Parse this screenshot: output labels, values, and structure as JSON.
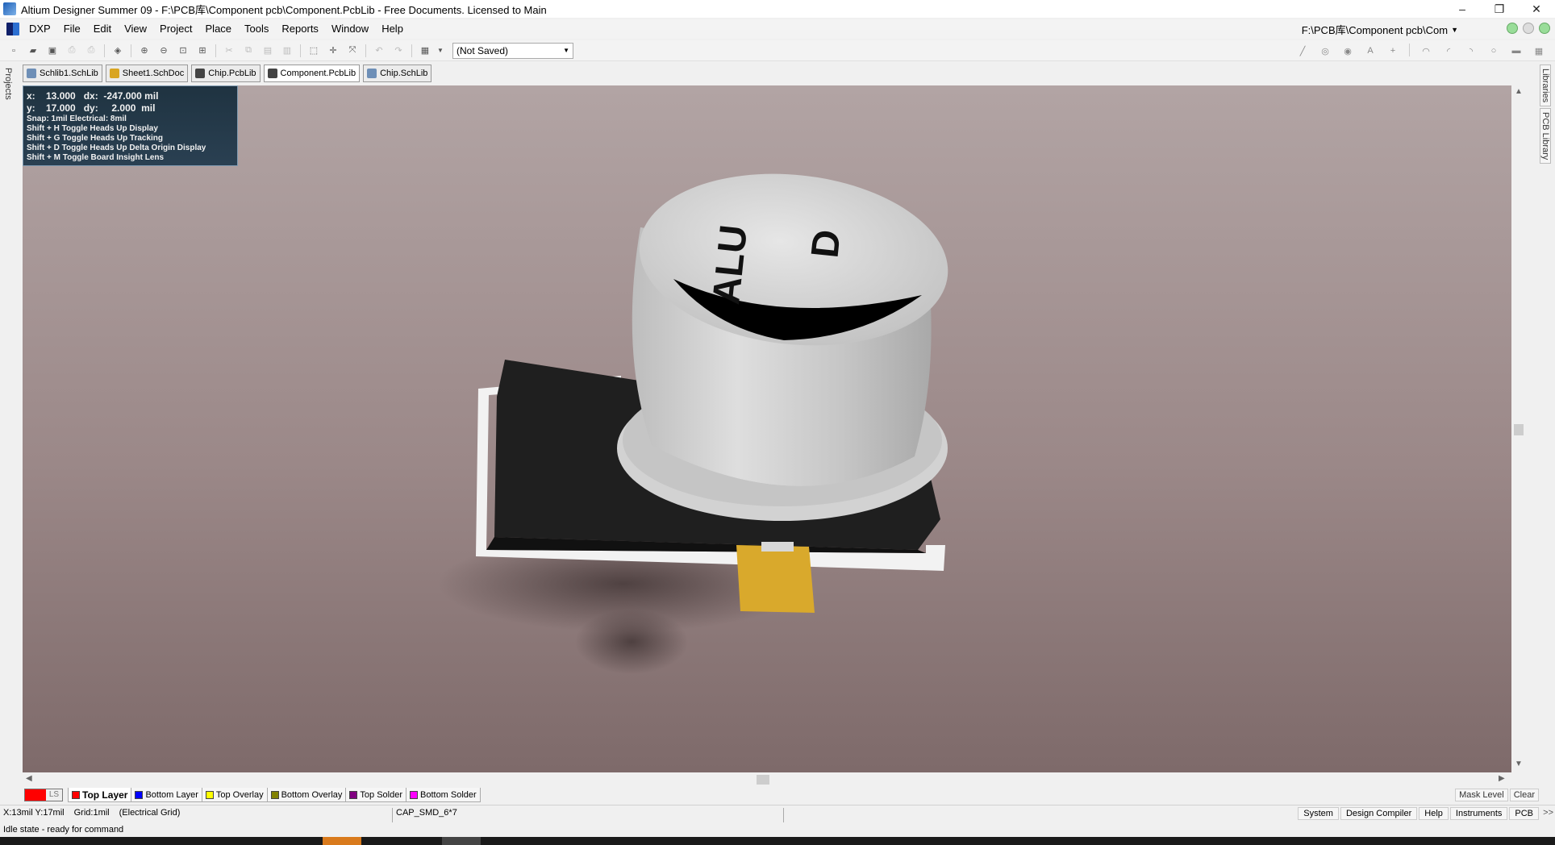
{
  "window": {
    "title": "Altium Designer Summer 09 - F:\\PCB库\\Component pcb\\Component.PcbLib - Free Documents. Licensed to Main",
    "buttons": [
      "–",
      "❐",
      "✕"
    ]
  },
  "menu": {
    "items": [
      "DXP",
      "File",
      "Edit",
      "View",
      "Project",
      "Place",
      "Tools",
      "Reports",
      "Window",
      "Help"
    ],
    "path": "F:\\PCB库\\Component pcb\\Com"
  },
  "toolbar": {
    "view_select": "(Not Saved)"
  },
  "doc_tabs": [
    {
      "label": "Schlib1.SchLib",
      "kind": "schlib"
    },
    {
      "label": "Sheet1.SchDoc",
      "kind": "sch"
    },
    {
      "label": "Chip.PcbLib",
      "kind": "pcb"
    },
    {
      "label": "Component.PcbLib",
      "kind": "pcb"
    },
    {
      "label": "Chip.SchLib",
      "kind": "schlib"
    }
  ],
  "side_panels": {
    "left": [
      "Projects"
    ],
    "right": [
      "Libraries",
      "PCB Library"
    ]
  },
  "hud": {
    "line1": "x:    13.000   dx:  -247.000 mil",
    "line2": "y:    17.000   dy:     2.000  mil",
    "snap": "Snap: 1mil Electrical: 8mil",
    "shortcuts": [
      "Shift + H  Toggle Heads Up Display",
      "Shift + G  Toggle Heads Up Tracking",
      "Shift + D  Toggle Heads Up Delta Origin Display",
      "Shift + M  Toggle Board Insight Lens"
    ]
  },
  "component": {
    "marking_top": "ALU",
    "marking_bottom": "D",
    "colors": {
      "cap_body": "#c8c8c8",
      "base": "#202020",
      "pad": "#d9a92c",
      "outline": "#f2f2f2"
    }
  },
  "layers": {
    "ls_label": "LS",
    "tabs": [
      {
        "label": "Top Layer",
        "color": "#ff0000",
        "active": true
      },
      {
        "label": "Bottom Layer",
        "color": "#0000ff",
        "active": false
      },
      {
        "label": "Top Overlay",
        "color": "#ffff00",
        "active": false
      },
      {
        "label": "Bottom Overlay",
        "color": "#808000",
        "active": false
      },
      {
        "label": "Top Solder",
        "color": "#800080",
        "active": false
      },
      {
        "label": "Bottom Solder",
        "color": "#ff00ff",
        "active": false
      }
    ],
    "right_buttons": [
      "Mask Level",
      "Clear"
    ]
  },
  "status": {
    "coords": "X:13mil Y:17mil",
    "grid": "Grid:1mil",
    "grid_type": "(Electrical Grid)",
    "component": "CAP_SMD_6*7",
    "panels": [
      "System",
      "Design Compiler",
      "Help",
      "Instruments",
      "PCB"
    ],
    "chevron": ">>",
    "idle": "Idle state - ready for command"
  }
}
